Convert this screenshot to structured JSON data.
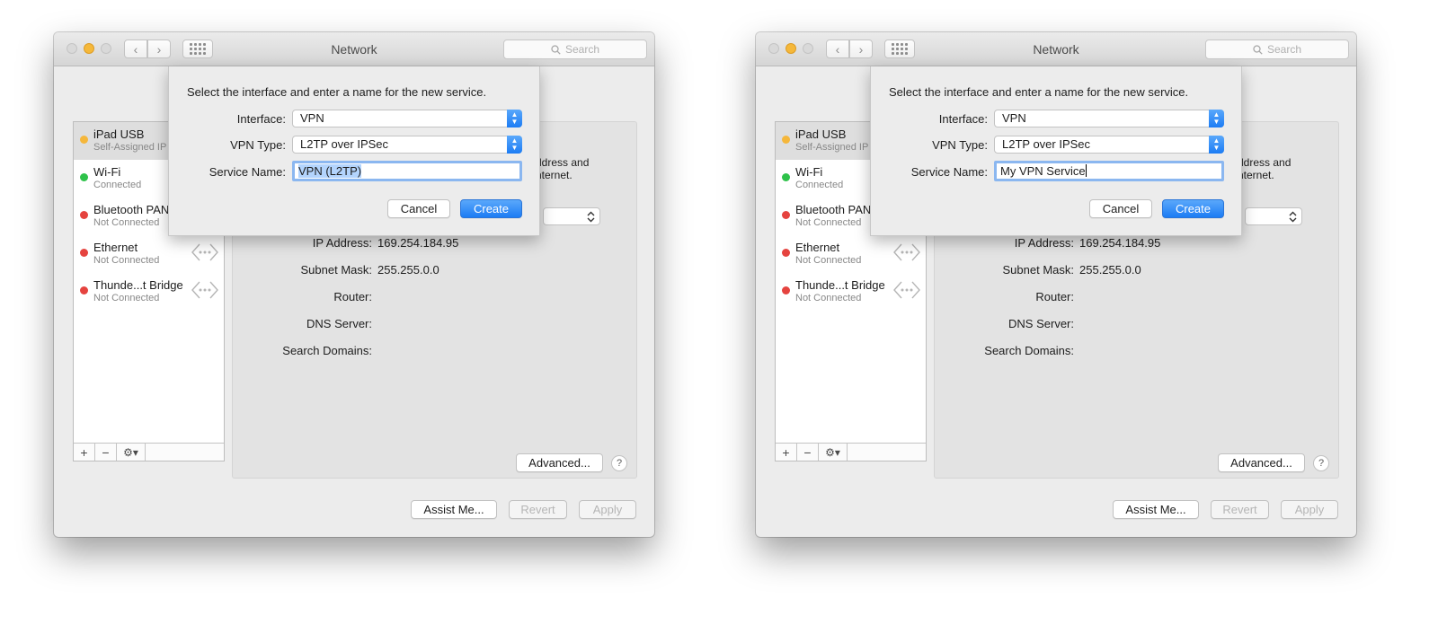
{
  "colors": {
    "accent": "#1c7cf4",
    "status_yellow": "#f5b73b",
    "status_green": "#2ec24a",
    "status_red": "#e5433f"
  },
  "windows": [
    {
      "title": "Network",
      "search_placeholder": "Search",
      "services": [
        {
          "name": "iPad USB",
          "status": "Self-Assigned IP",
          "state": "yellow",
          "selected": true,
          "arrows": false
        },
        {
          "name": "Wi-Fi",
          "status": "Connected",
          "state": "green",
          "selected": false,
          "arrows": false
        },
        {
          "name": "Bluetooth PAN",
          "status": "Not Connected",
          "state": "red",
          "selected": false,
          "arrows": false
        },
        {
          "name": "Ethernet",
          "status": "Not Connected",
          "state": "red",
          "selected": false,
          "arrows": true
        },
        {
          "name": "Thunde...t Bridge",
          "status": "Not Connected",
          "state": "red",
          "selected": false,
          "arrows": true
        }
      ],
      "toolbar": {
        "add": "+",
        "remove": "−",
        "action": "⚙▾"
      },
      "partial_text": [
        "ddress and",
        "nternet."
      ],
      "details": [
        {
          "label": "IP Address:",
          "value": "169.254.184.95"
        },
        {
          "label": "Subnet Mask:",
          "value": "255.255.0.0"
        },
        {
          "label": "Router:",
          "value": ""
        },
        {
          "label": "DNS Server:",
          "value": ""
        },
        {
          "label": "Search Domains:",
          "value": ""
        }
      ],
      "buttons": {
        "advanced": "Advanced...",
        "help": "?",
        "assist": "Assist Me...",
        "revert": "Revert",
        "apply": "Apply"
      },
      "sheet": {
        "prompt": "Select the interface and enter a name for the new service.",
        "interface_label": "Interface:",
        "interface_value": "VPN",
        "vpn_type_label": "VPN Type:",
        "vpn_type_value": "L2TP over IPSec",
        "service_name_label": "Service Name:",
        "service_name_value": "VPN (L2TP)",
        "service_name_selected": true,
        "cancel": "Cancel",
        "create": "Create"
      }
    },
    {
      "title": "Network",
      "search_placeholder": "Search",
      "services": [
        {
          "name": "iPad USB",
          "status": "Self-Assigned IP",
          "state": "yellow",
          "selected": true,
          "arrows": false
        },
        {
          "name": "Wi-Fi",
          "status": "Connected",
          "state": "green",
          "selected": false,
          "arrows": false
        },
        {
          "name": "Bluetooth PAN",
          "status": "Not Connected",
          "state": "red",
          "selected": false,
          "arrows": false
        },
        {
          "name": "Ethernet",
          "status": "Not Connected",
          "state": "red",
          "selected": false,
          "arrows": true
        },
        {
          "name": "Thunde...t Bridge",
          "status": "Not Connected",
          "state": "red",
          "selected": false,
          "arrows": true
        }
      ],
      "toolbar": {
        "add": "+",
        "remove": "−",
        "action": "⚙▾"
      },
      "partial_text": [
        "ddress and",
        "nternet."
      ],
      "details": [
        {
          "label": "IP Address:",
          "value": "169.254.184.95"
        },
        {
          "label": "Subnet Mask:",
          "value": "255.255.0.0"
        },
        {
          "label": "Router:",
          "value": ""
        },
        {
          "label": "DNS Server:",
          "value": ""
        },
        {
          "label": "Search Domains:",
          "value": ""
        }
      ],
      "buttons": {
        "advanced": "Advanced...",
        "help": "?",
        "assist": "Assist Me...",
        "revert": "Revert",
        "apply": "Apply"
      },
      "sheet": {
        "prompt": "Select the interface and enter a name for the new service.",
        "interface_label": "Interface:",
        "interface_value": "VPN",
        "vpn_type_label": "VPN Type:",
        "vpn_type_value": "L2TP over IPSec",
        "service_name_label": "Service Name:",
        "service_name_value": "My VPN Service",
        "service_name_selected": false,
        "cancel": "Cancel",
        "create": "Create"
      }
    }
  ]
}
